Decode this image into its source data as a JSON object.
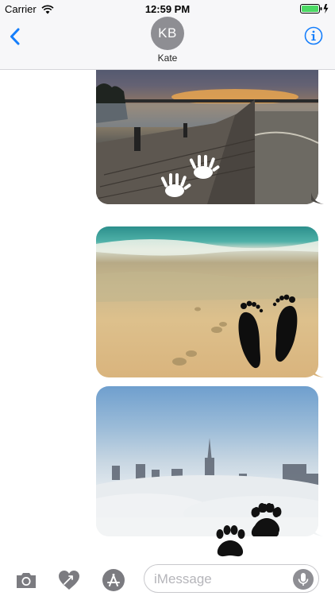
{
  "status_bar": {
    "carrier": "Carrier",
    "time": "12:59 PM"
  },
  "header": {
    "avatar_initials": "KB",
    "contact_name": "Kate"
  },
  "messages": [
    {
      "kind": "photo",
      "scene": "pier at sunset",
      "sticker": "hand-print-sticker"
    },
    {
      "kind": "photo",
      "scene": "beach footprints",
      "sticker": "footprints-sticker"
    },
    {
      "kind": "photo",
      "scene": "city above clouds",
      "sticker": "paw-print-sticker"
    }
  ],
  "input": {
    "placeholder": "iMessage"
  },
  "colors": {
    "accent": "#157efb",
    "avatar": "#8e8e93",
    "icon_gray": "#7b7b80"
  },
  "icons": [
    "chevron-left-icon",
    "info-icon",
    "camera-icon",
    "heart-icon",
    "app-store-icon",
    "microphone-icon"
  ]
}
